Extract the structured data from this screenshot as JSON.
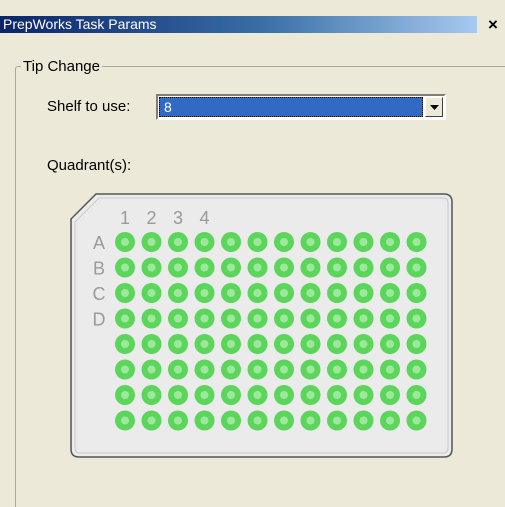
{
  "window": {
    "title": "PrepWorks Task Params",
    "close_glyph": "×"
  },
  "group": {
    "label": "Tip Change"
  },
  "shelf": {
    "label": "Shelf to use:",
    "selected": "8"
  },
  "quadrant": {
    "label": "Quadrant(s):",
    "column_labels": [
      "1",
      "2",
      "3",
      "4"
    ],
    "row_labels": [
      "A",
      "B",
      "C",
      "D"
    ]
  },
  "plate": {
    "rows": 8,
    "columns": 12,
    "well_color": "#5bd65b",
    "well_center_color": "#9ee89e",
    "plate_fill": "#ebebeb",
    "plate_border": "#555555",
    "label_color": "#9a9a9a"
  },
  "icons": {
    "close": "close-icon",
    "dropdown": "chevron-down-icon"
  }
}
